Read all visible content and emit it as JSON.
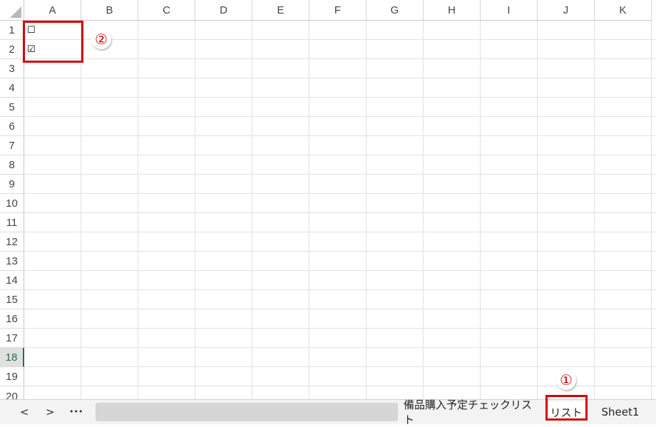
{
  "columns": [
    "A",
    "B",
    "C",
    "D",
    "E",
    "F",
    "G",
    "H",
    "I",
    "J",
    "K"
  ],
  "rows": [
    "1",
    "2",
    "3",
    "4",
    "5",
    "6",
    "7",
    "8",
    "9",
    "10",
    "11",
    "12",
    "13",
    "14",
    "15",
    "16",
    "17",
    "18",
    "19",
    "20"
  ],
  "active_row": "18",
  "cells": {
    "A1": "☐",
    "A2": "☑"
  },
  "annotations": {
    "marker1": "①",
    "marker2": "②"
  },
  "tabs": {
    "nav_prev": "<",
    "nav_next": ">",
    "nav_more": "•••",
    "sheet1": "備品購入予定チェックリスト",
    "sheet2": "リスト",
    "sheet3": "Sheet1"
  },
  "colors": {
    "annotation_red": "#d40000",
    "excel_green": "#217346"
  }
}
